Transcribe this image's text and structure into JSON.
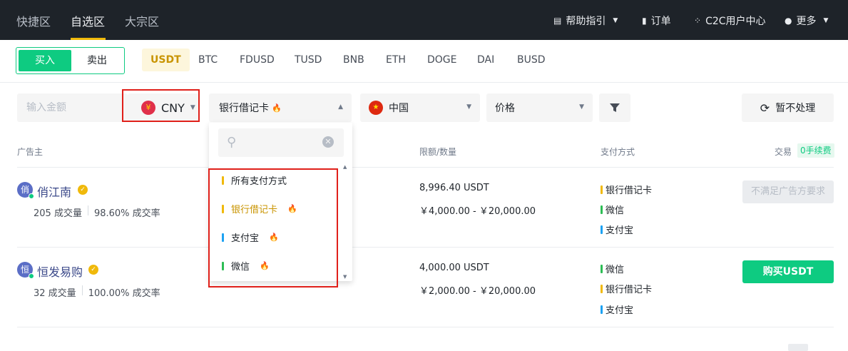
{
  "nav": {
    "tabs": [
      "快捷区",
      "自选区",
      "大宗区"
    ],
    "help_label": "帮助指引",
    "orders_label": "订单",
    "c2c_label": "C2C用户中心",
    "more_label": "更多"
  },
  "trade_side": {
    "buy_label": "买入",
    "sell_label": "卖出"
  },
  "coins": [
    "USDT",
    "BTC",
    "FDUSD",
    "TUSD",
    "BNB",
    "ETH",
    "DOGE",
    "DAI",
    "BUSD"
  ],
  "filters": {
    "amount_placeholder": "输入金额",
    "currency": "CNY",
    "currency_symbol": "¥",
    "payment_method": "银行借记卡",
    "region": "中国",
    "region_flag": "★",
    "sort": "价格",
    "refresh_label": "暂不处理"
  },
  "dropdown": {
    "items": [
      {
        "label": "所有支付方式",
        "color": "#f0b90b",
        "hot": false
      },
      {
        "label": "银行借记卡",
        "color": "#f0b90b",
        "hot": true,
        "selected": true
      },
      {
        "label": "支付宝",
        "color": "#1da2f2",
        "hot": true
      },
      {
        "label": "微信",
        "color": "#2dbd55",
        "hot": true
      }
    ]
  },
  "table": {
    "headers": {
      "advertiser": "广告主",
      "limit": "限额/数量",
      "payment": "支付方式",
      "trade": "交易",
      "fee_badge": "0手续费"
    },
    "rows": [
      {
        "avatar": "俏",
        "name": "俏江南",
        "orders": "205 成交量",
        "rate": "98.60% 成交率",
        "quantity": "8,996.40 USDT",
        "limit": "￥4,000.00 - ￥20,000.00",
        "payments": [
          {
            "label": "银行借记卡",
            "color": "#f0b90b"
          },
          {
            "label": "微信",
            "color": "#2dbd55"
          },
          {
            "label": "支付宝",
            "color": "#1da2f2"
          }
        ],
        "action": "不满足广告方要求"
      },
      {
        "avatar": "恒",
        "name": "恒发易购",
        "orders": "32 成交量",
        "rate": "100.00% 成交率",
        "quantity": "4,000.00 USDT",
        "limit": "￥2,000.00 - ￥20,000.00",
        "payments": [
          {
            "label": "微信",
            "color": "#2dbd55"
          },
          {
            "label": "银行借记卡",
            "color": "#f0b90b"
          },
          {
            "label": "支付宝",
            "color": "#1da2f2"
          }
        ],
        "action": "购买USDT"
      }
    ]
  }
}
